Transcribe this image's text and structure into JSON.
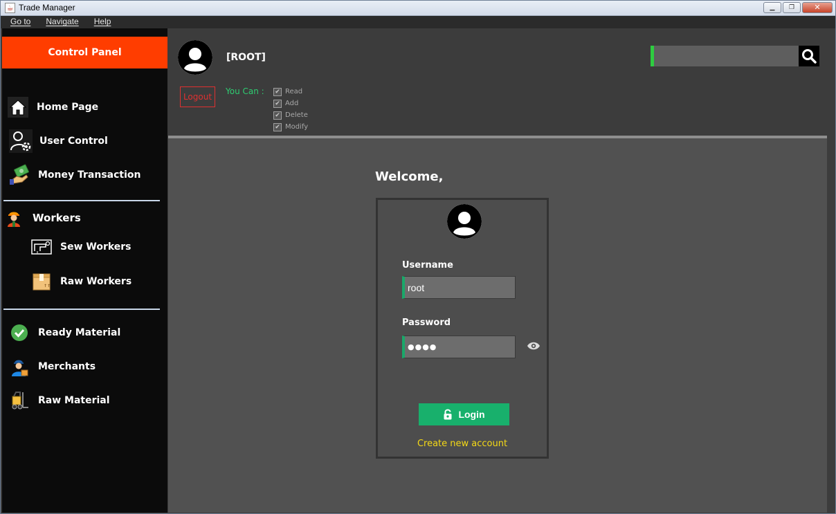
{
  "window": {
    "title": "Trade Manager",
    "controls": [
      "minimize",
      "maximize",
      "close"
    ]
  },
  "menubar": {
    "items": [
      {
        "label": "Go to"
      },
      {
        "label": "Navigate"
      },
      {
        "label": "Help"
      }
    ]
  },
  "sidebar": {
    "header": "Control Panel",
    "items": [
      {
        "label": "Home Page",
        "icon": "home-icon"
      },
      {
        "label": "User Control",
        "icon": "user-settings-icon"
      },
      {
        "label": "Money Transaction",
        "icon": "money-hand-icon"
      },
      {
        "label": "Workers",
        "icon": "worker-icon"
      },
      {
        "label": "Sew Workers",
        "icon": "sewing-machine-icon"
      },
      {
        "label": "Raw Workers",
        "icon": "box-icon"
      },
      {
        "label": "Ready Material",
        "icon": "check-circle-icon"
      },
      {
        "label": "Merchants",
        "icon": "merchant-icon"
      },
      {
        "label": "Raw Material",
        "icon": "forklift-icon"
      }
    ]
  },
  "header": {
    "user_label": "[ROOT]",
    "logout_label": "Logout",
    "you_can_label": "You Can :",
    "permissions": [
      {
        "label": "Read",
        "checked": true
      },
      {
        "label": "Add",
        "checked": true
      },
      {
        "label": "Delete",
        "checked": true
      },
      {
        "label": "Modify",
        "checked": true
      }
    ],
    "search": {
      "value": "",
      "icon": "search-icon"
    }
  },
  "login": {
    "welcome": "Welcome,",
    "username_label": "Username",
    "username_value": "root",
    "password_label": "Password",
    "password_mask": "●●●●",
    "login_label": "Login",
    "create_account": "Create new account"
  },
  "colors": {
    "accent_orange": "#ff3d00",
    "accent_green": "#18b06c",
    "link_yellow": "#f5d916",
    "logout_red": "#e03030",
    "permission_green": "#2ecc71"
  }
}
